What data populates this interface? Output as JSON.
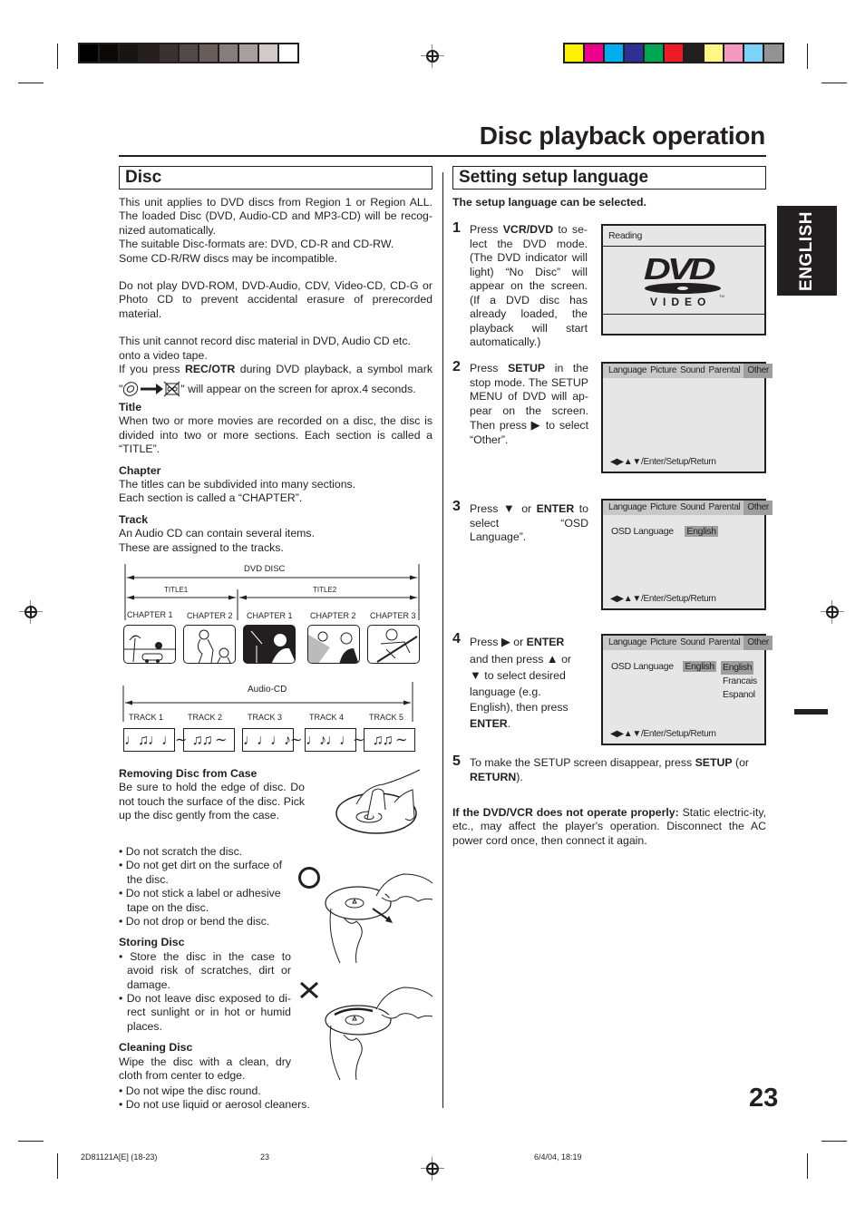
{
  "page": {
    "title": "Disc playback operation",
    "page_number": "23",
    "side_tab": "ENGLISH"
  },
  "color_bars": {
    "grayscale": [
      "#000000",
      "#0c0a09",
      "#181413",
      "#25201e",
      "#3a3230",
      "#524845",
      "#685d5a",
      "#877d7a",
      "#a89f9c",
      "#d2cac8",
      "#ffffff"
    ],
    "colors": [
      "#fff200",
      "#ec008c",
      "#00aeef",
      "#2e3192",
      "#00a651",
      "#ed1c24",
      "#231f20",
      "#fff685",
      "#f49ac1",
      "#7dd3f7",
      "#939393"
    ]
  },
  "disc": {
    "heading": "Disc",
    "para1": "This unit applies to DVD discs from Region 1 or Region ALL. The loaded Disc (DVD, Audio-CD and MP3-CD) will be recog-nized automatically.",
    "para1b": "The suitable Disc-formats are: DVD, CD-R and CD-RW.",
    "para1c": "Some CD-R/RW discs may be incompatible.",
    "para2": "Do not play DVD-ROM, DVD-Audio, CDV, Video-CD, CD-G or Photo CD to prevent accidental erasure of prerecorded material.",
    "para3": "This unit cannot record disc material in DVD, Audio CD etc. onto a video tape.",
    "para4_pre": "If you press ",
    "para4_bold": "REC/OTR",
    "para4_post": " during DVD playback, a symbol mark",
    "para5_open": "\"",
    "para5_post": "\" will appear on the screen for aprox.4 seconds.",
    "title_head": "Title",
    "title_text": "When two or more movies are recorded on a disc, the disc is divided into two or more sections. Each section is called a “TITLE”.",
    "chapter_head": "Chapter",
    "chapter_text1": "The titles can be subdivided into many sections.",
    "chapter_text2": "Each section is called a “CHAPTER”.",
    "track_head": "Track",
    "track_text1": "An Audio CD can contain several items.",
    "track_text2": "These are assigned to the tracks."
  },
  "dvd_diagram": {
    "disc_label": "DVD DISC",
    "titles": [
      "TITLE1",
      "TITLE2"
    ],
    "chapters": [
      "CHAPTER 1",
      "CHAPTER 2",
      "CHAPTER 1",
      "CHAPTER 2",
      "CHAPTER 3"
    ],
    "audio_label": "Audio-CD",
    "tracks": [
      "TRACK  1",
      "TRACK  2",
      "TRACK  3",
      "TRACK  4",
      "TRACK  5"
    ],
    "track_notes": [
      "♩♫♩♩∼",
      "♫♫ ∼",
      "♩♩♩♪∼",
      "♩♪♩♩∼",
      "♫♫ ∼"
    ]
  },
  "care": {
    "removing_head": "Removing Disc from Case",
    "removing_text": "Be sure to hold the edge of disc. Do not touch the surface of the disc. Pick up the disc gently from the case.",
    "bullets": [
      "Do not scratch the disc.",
      "Do not get dirt on the surface of the disc.",
      "Do not stick a label or adhesive tape on the disc.",
      "Do not drop or bend the disc."
    ],
    "storing_head": "Storing Disc",
    "storing_bullets": [
      "Store the disc in the case to avoid risk of scratches, dirt or damage.",
      "Do not leave disc exposed to di-rect sunlight or in hot or humid places."
    ],
    "cleaning_head": "Cleaning Disc",
    "cleaning_text": "Wipe the disc with a clean, dry cloth from center to edge.",
    "cleaning_bullets": [
      "Do not wipe the disc round.",
      "Do not use liquid or aerosol cleaners."
    ]
  },
  "setup": {
    "heading": "Setting setup language",
    "intro": "The setup language can be selected.",
    "steps": [
      {
        "num": "1",
        "pre": "Press ",
        "bold": "VCR/DVD",
        "post": " to se-lect the DVD mode. (The DVD indicator will light) “No Disc” will appear on the screen. (If a DVD disc has already loaded, the playback will start automatically.)"
      },
      {
        "num": "2",
        "pre": "Press ",
        "bold": "SETUP",
        "post": " in the stop mode. The SETUP MENU of DVD will ap-pear on the screen. Then press ",
        "post2": " to select “Other”."
      },
      {
        "num": "3",
        "pre": "Press ",
        "mid": " or ",
        "bold": "ENTER",
        "post": " to select “OSD Language”."
      },
      {
        "num": "4",
        "pre": "Press ",
        "mid": " or ",
        "bold": "ENTER",
        "post": " and then press ",
        "post2": " or ",
        "post3": " to select desired language (e.g. English), then press ",
        "bold2": "ENTER",
        "end": "."
      },
      {
        "num": "5",
        "pre": "To make the SETUP screen disappear, press ",
        "bold": "SETUP",
        "post": " (or ",
        "bold2": "RETURN",
        "end": ")."
      }
    ],
    "warning_bold": "If the DVD/VCR does not operate properly:",
    "warning_text": " Static electric-ity, etc., may affect the player's operation. Disconnect the AC power cord once, then connect it again."
  },
  "osd": {
    "reading": "Reading",
    "logo_top": "DVD",
    "logo_bottom": "VIDEO",
    "tm": "TM",
    "menu_tabs": [
      "Language",
      "Picture",
      "Sound",
      "Parental",
      "Other"
    ],
    "selected_tab": "Other",
    "nav_hint": "◀▶▲▼/Enter/Setup/Return",
    "osd_language_label": "OSD Language",
    "osd_language_value": "English",
    "language_options": [
      "English",
      "Francais",
      "Espanol"
    ],
    "selected_option": "English"
  },
  "footer": {
    "doc_code": "2D81121A[E] (18-23)",
    "page": "23",
    "timestamp": "6/4/04, 18:19"
  }
}
